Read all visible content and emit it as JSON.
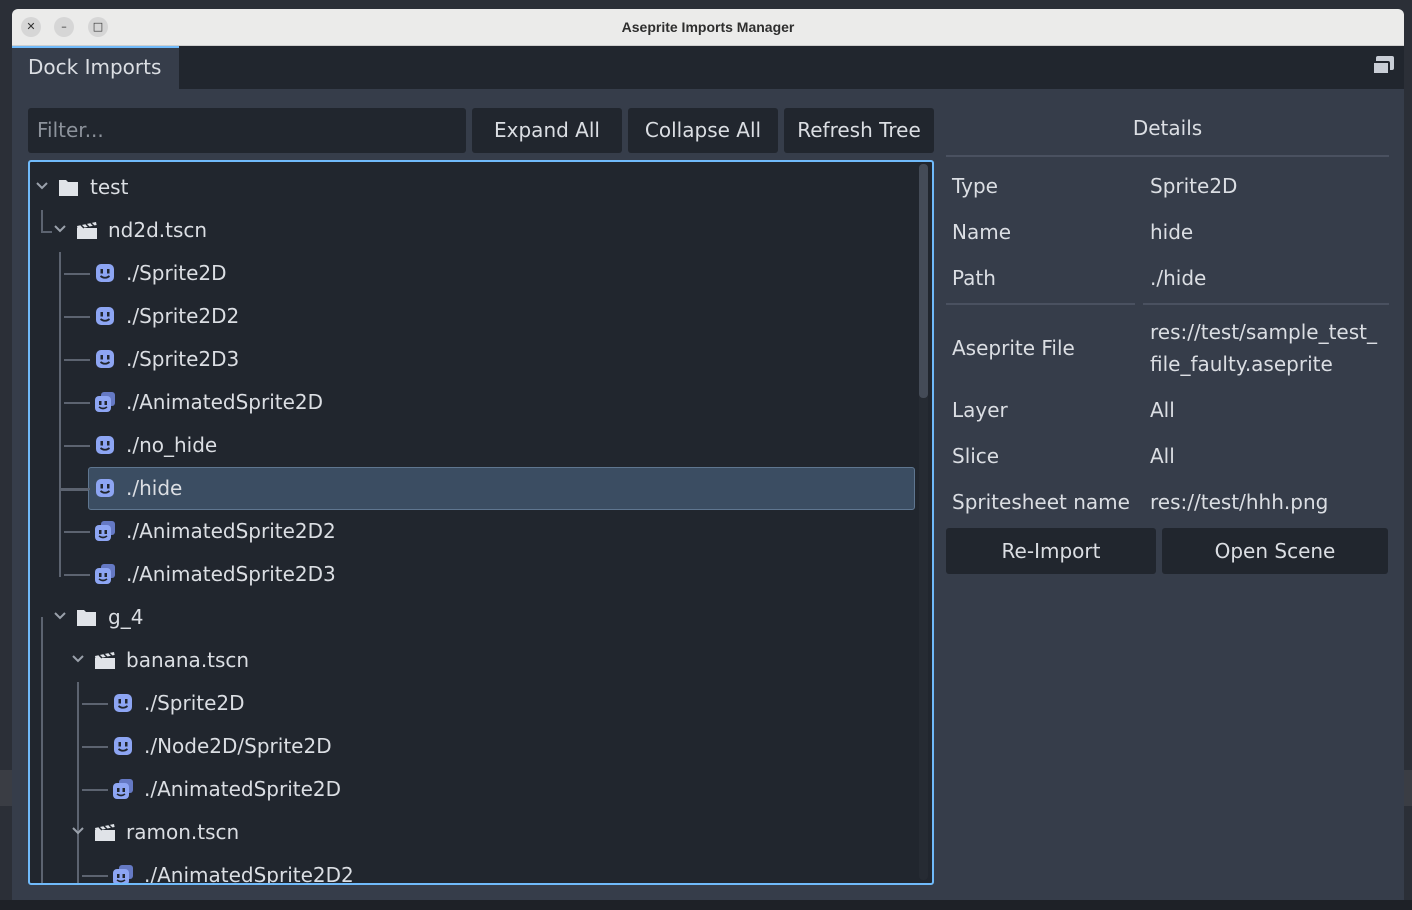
{
  "window": {
    "title": "Aseprite Imports Manager",
    "close_glyph": "✕",
    "minimize_glyph": "–",
    "maximize_glyph": "□"
  },
  "dock": {
    "tab_label": "Dock Imports"
  },
  "toolbar": {
    "filter_placeholder": "Filter...",
    "expand_label": "Expand All",
    "collapse_label": "Collapse All",
    "refresh_label": "Refresh Tree"
  },
  "tree": {
    "items": [
      {
        "label": "test",
        "icon": "folder-icon",
        "expanded": true
      },
      {
        "label": "nd2d.tscn",
        "icon": "scene-clapper-icon",
        "expanded": true
      },
      {
        "label": "./Sprite2D",
        "icon": "sprite2d-icon"
      },
      {
        "label": "./Sprite2D2",
        "icon": "sprite2d-icon"
      },
      {
        "label": "./Sprite2D3",
        "icon": "sprite2d-icon"
      },
      {
        "label": "./AnimatedSprite2D",
        "icon": "animated-sprite2d-icon"
      },
      {
        "label": "./no_hide",
        "icon": "sprite2d-icon"
      },
      {
        "label": "./hide",
        "icon": "sprite2d-icon",
        "selected": true
      },
      {
        "label": "./AnimatedSprite2D2",
        "icon": "animated-sprite2d-icon"
      },
      {
        "label": "./AnimatedSprite2D3",
        "icon": "animated-sprite2d-icon"
      },
      {
        "label": "g_4",
        "icon": "folder-icon",
        "expanded": true
      },
      {
        "label": "banana.tscn",
        "icon": "scene-clapper-icon",
        "expanded": true
      },
      {
        "label": "./Sprite2D",
        "icon": "sprite2d-icon"
      },
      {
        "label": "./Node2D/Sprite2D",
        "icon": "sprite2d-icon"
      },
      {
        "label": "./AnimatedSprite2D",
        "icon": "animated-sprite2d-icon"
      },
      {
        "label": "ramon.tscn",
        "icon": "scene-clapper-icon",
        "expanded": true
      },
      {
        "label": "./AnimatedSprite2D2",
        "icon": "animated-sprite2d-icon"
      }
    ]
  },
  "details": {
    "title": "Details",
    "type_label": "Type",
    "type_value": "Sprite2D",
    "name_label": "Name",
    "name_value": "hide",
    "path_label": "Path",
    "path_value": "./hide",
    "file_label": "Aseprite File",
    "file_value_line1": "res://test/sample_test_",
    "file_value_line2": "file_faulty.aseprite",
    "layer_label": "Layer",
    "layer_value": "All",
    "slice_label": "Slice",
    "slice_value": "All",
    "sheet_label": "Spritesheet name",
    "sheet_value": "res://test/hhh.png"
  },
  "actions": {
    "reimport_label": "Re-Import",
    "open_scene_label": "Open Scene"
  },
  "colors": {
    "accent": "#70bafa",
    "panel": "#363d4a",
    "field": "#21262e",
    "selection": "#3b4d62",
    "sprite_icon": "#8da5f3"
  }
}
